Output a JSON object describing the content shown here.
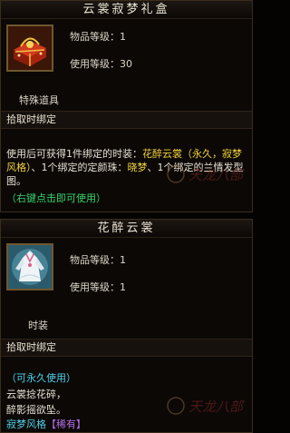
{
  "item1": {
    "title": "云裳寂梦礼盒",
    "level_label": "物品等级：1",
    "use_level_label": "使用等级：30",
    "type_label": "特殊道具",
    "bind_label": "拾取时绑定",
    "desc": {
      "p1": "使用后可获得1件绑定的时装：",
      "p2": "花醉云裳（永久，寂梦风格）",
      "p3": "、1个绑定的定颜珠：",
      "p4": "晓梦",
      "p5": "、1个绑定的兰情发型图。"
    },
    "hint": "（右键点击即可使用）",
    "icon": "red-gift-box-icon"
  },
  "item2": {
    "title": "花醉云裳",
    "level_label": "物品等级：1",
    "use_level_label": "使用等级：1",
    "type_label": "时装",
    "bind_label": "拾取时绑定",
    "permanent": "（可永久使用）",
    "flavor1": "云裳捻花碎，",
    "flavor2": "醉影摇欲坠。",
    "style_label": "寂梦风格",
    "rarity": "【稀有】",
    "icon": "white-dress-icon"
  },
  "watermark": "天龙八部",
  "colors": {
    "yellow": "#f4d23c",
    "green": "#38d36a",
    "cyan": "#4fd0e8",
    "purple": "#b56ee6"
  }
}
